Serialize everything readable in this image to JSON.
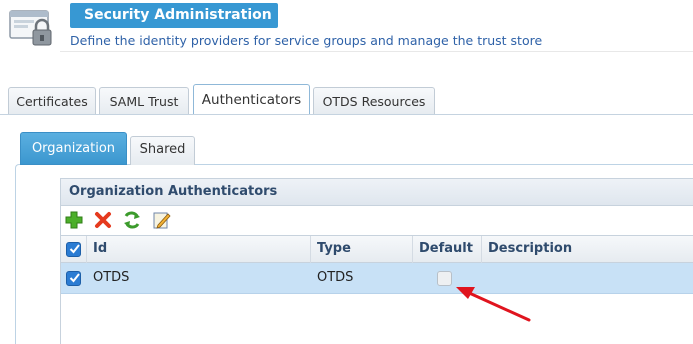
{
  "header": {
    "title": "Security Administration",
    "subtitle": "Define the identity providers for service groups and manage the trust store",
    "icon": "lock-window-icon"
  },
  "main_tabs": [
    {
      "label": "Certificates",
      "active": false
    },
    {
      "label": "SAML Trust",
      "active": false
    },
    {
      "label": "Authenticators",
      "active": true
    },
    {
      "label": "OTDS Resources",
      "active": false
    }
  ],
  "sub_tabs": [
    {
      "label": "Organization",
      "active": true
    },
    {
      "label": "Shared",
      "active": false
    }
  ],
  "grid": {
    "title": "Organization Authenticators",
    "toolbar": {
      "add": "add-icon",
      "delete": "delete-icon",
      "refresh": "refresh-icon",
      "edit": "edit-icon"
    },
    "columns": [
      "Id",
      "Type",
      "Default",
      "Description"
    ],
    "select_all_checked": true,
    "rows": [
      {
        "selected": true,
        "id": "OTDS",
        "type": "OTDS",
        "default": false,
        "description": ""
      }
    ]
  },
  "colors": {
    "accent": "#3798d3",
    "row_selected": "#c8e1f6",
    "annotation_arrow": "#e0141e"
  }
}
